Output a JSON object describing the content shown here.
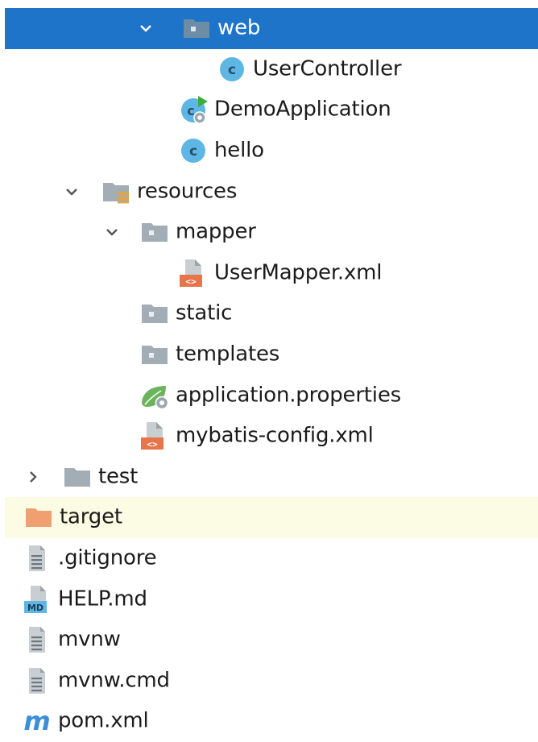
{
  "colors": {
    "selected_bg": "#1e74c8",
    "highlight_bg": "#fcfbe3",
    "folder_gray": "#a3adb5",
    "folder_blue": "#6d8ca6",
    "target_orange": "#f0a070",
    "class_cyan": "#5eb6e4",
    "xml_orange": "#e8744a",
    "spring_green": "#6bb35c",
    "maven_blue": "#3a8fd8"
  },
  "tree": {
    "items": [
      {
        "label": "web",
        "icon": "package-folder-icon",
        "arrow": "chevron-down-icon"
      },
      {
        "label": "UserController",
        "icon": "class-icon"
      },
      {
        "label": "DemoApplication",
        "icon": "spring-boot-class-icon"
      },
      {
        "label": "hello",
        "icon": "class-icon"
      },
      {
        "label": "resources",
        "icon": "resources-folder-icon",
        "arrow": "chevron-down-icon"
      },
      {
        "label": "mapper",
        "icon": "folder-icon",
        "arrow": "chevron-down-icon"
      },
      {
        "label": "UserMapper.xml",
        "icon": "xml-file-icon"
      },
      {
        "label": "static",
        "icon": "folder-icon"
      },
      {
        "label": "templates",
        "icon": "folder-icon"
      },
      {
        "label": "application.properties",
        "icon": "spring-properties-icon"
      },
      {
        "label": "mybatis-config.xml",
        "icon": "xml-file-icon"
      },
      {
        "label": "test",
        "icon": "folder-icon",
        "arrow": "chevron-right-icon"
      },
      {
        "label": "target",
        "icon": "excluded-folder-icon"
      },
      {
        "label": ".gitignore",
        "icon": "text-file-icon"
      },
      {
        "label": "HELP.md",
        "icon": "markdown-file-icon"
      },
      {
        "label": "mvnw",
        "icon": "text-file-icon"
      },
      {
        "label": "mvnw.cmd",
        "icon": "text-file-icon"
      },
      {
        "label": "pom.xml",
        "icon": "maven-icon"
      }
    ]
  }
}
